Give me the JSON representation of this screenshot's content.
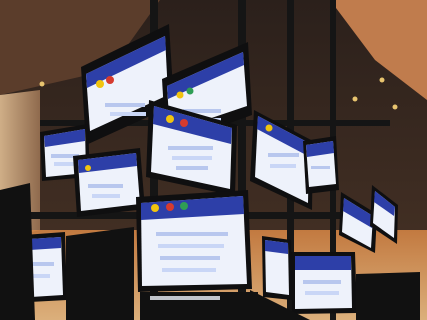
{
  "scene": {
    "subject": "suspended-monitor-cluster",
    "screens": [
      {
        "id": 1,
        "header": "blue",
        "content": "white"
      },
      {
        "id": 2,
        "header": "blue",
        "content": "white"
      },
      {
        "id": 3,
        "header": "blue",
        "content": "white"
      },
      {
        "id": 4,
        "header": "blue",
        "content": "white"
      },
      {
        "id": 5,
        "header": "blue",
        "content": "white"
      },
      {
        "id": 6,
        "header": "blue",
        "content": "white"
      },
      {
        "id": 7,
        "header": "blue",
        "content": "white"
      },
      {
        "id": 8,
        "header": "blue",
        "content": "white"
      },
      {
        "id": 9,
        "header": "blue",
        "content": "white"
      },
      {
        "id": 10,
        "header": "blue",
        "content": "white"
      },
      {
        "id": 11,
        "header": "blue",
        "content": "white"
      },
      {
        "id": 12,
        "header": "blue",
        "content": "white"
      }
    ]
  },
  "colors": {
    "ceiling": "#3a2a22",
    "ceiling_panel": "#b7754b",
    "wall_left": "#b8926e",
    "frame": "#141414",
    "screen_header": "#2d3fa8",
    "screen_body": "#eef2fb",
    "accent_yellow": "#f1c40f",
    "accent_red": "#d63b2f",
    "accent_green": "#2f9e55",
    "floor_glow": "#e08b43"
  }
}
